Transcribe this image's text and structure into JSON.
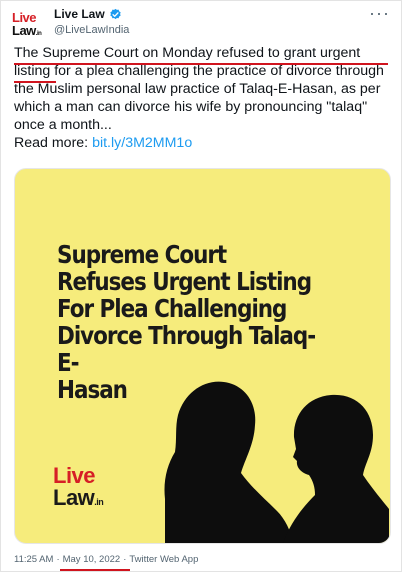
{
  "author": {
    "avatar_line1": "Live",
    "avatar_line2": "Law",
    "avatar_suffix": ".in",
    "name": "Live Law",
    "handle": "@LiveLawIndia",
    "verified_icon": "verified-badge-icon",
    "more_icon": "more-options-icon",
    "verified_color": "#1d9bf0"
  },
  "tweet": {
    "text": "The Supreme Court on Monday refused to grant urgent listing for a plea challenging the practice of divorce through the Muslim personal law practice of Talaq-E-Hasan, as per which a man can divorce his wife by pronouncing \"talaq\" once a month...",
    "read_more_label": "Read more:",
    "link_text": "bit.ly/3M2MM1o",
    "link_color": "#1d9bf0"
  },
  "media": {
    "headline": "Supreme Court\nRefuses Urgent Listing\nFor Plea Challenging\nDivorce Through Talaq-E-\nHasan",
    "brand_line1": "Live",
    "brand_line2": "Law",
    "brand_suffix": ".in",
    "background_color": "#f6ec7c"
  },
  "meta": {
    "time": "11:25 AM",
    "separator": "·",
    "date": "May 10, 2022",
    "source": "Twitter Web App"
  },
  "annotation_color": "#d0141e"
}
